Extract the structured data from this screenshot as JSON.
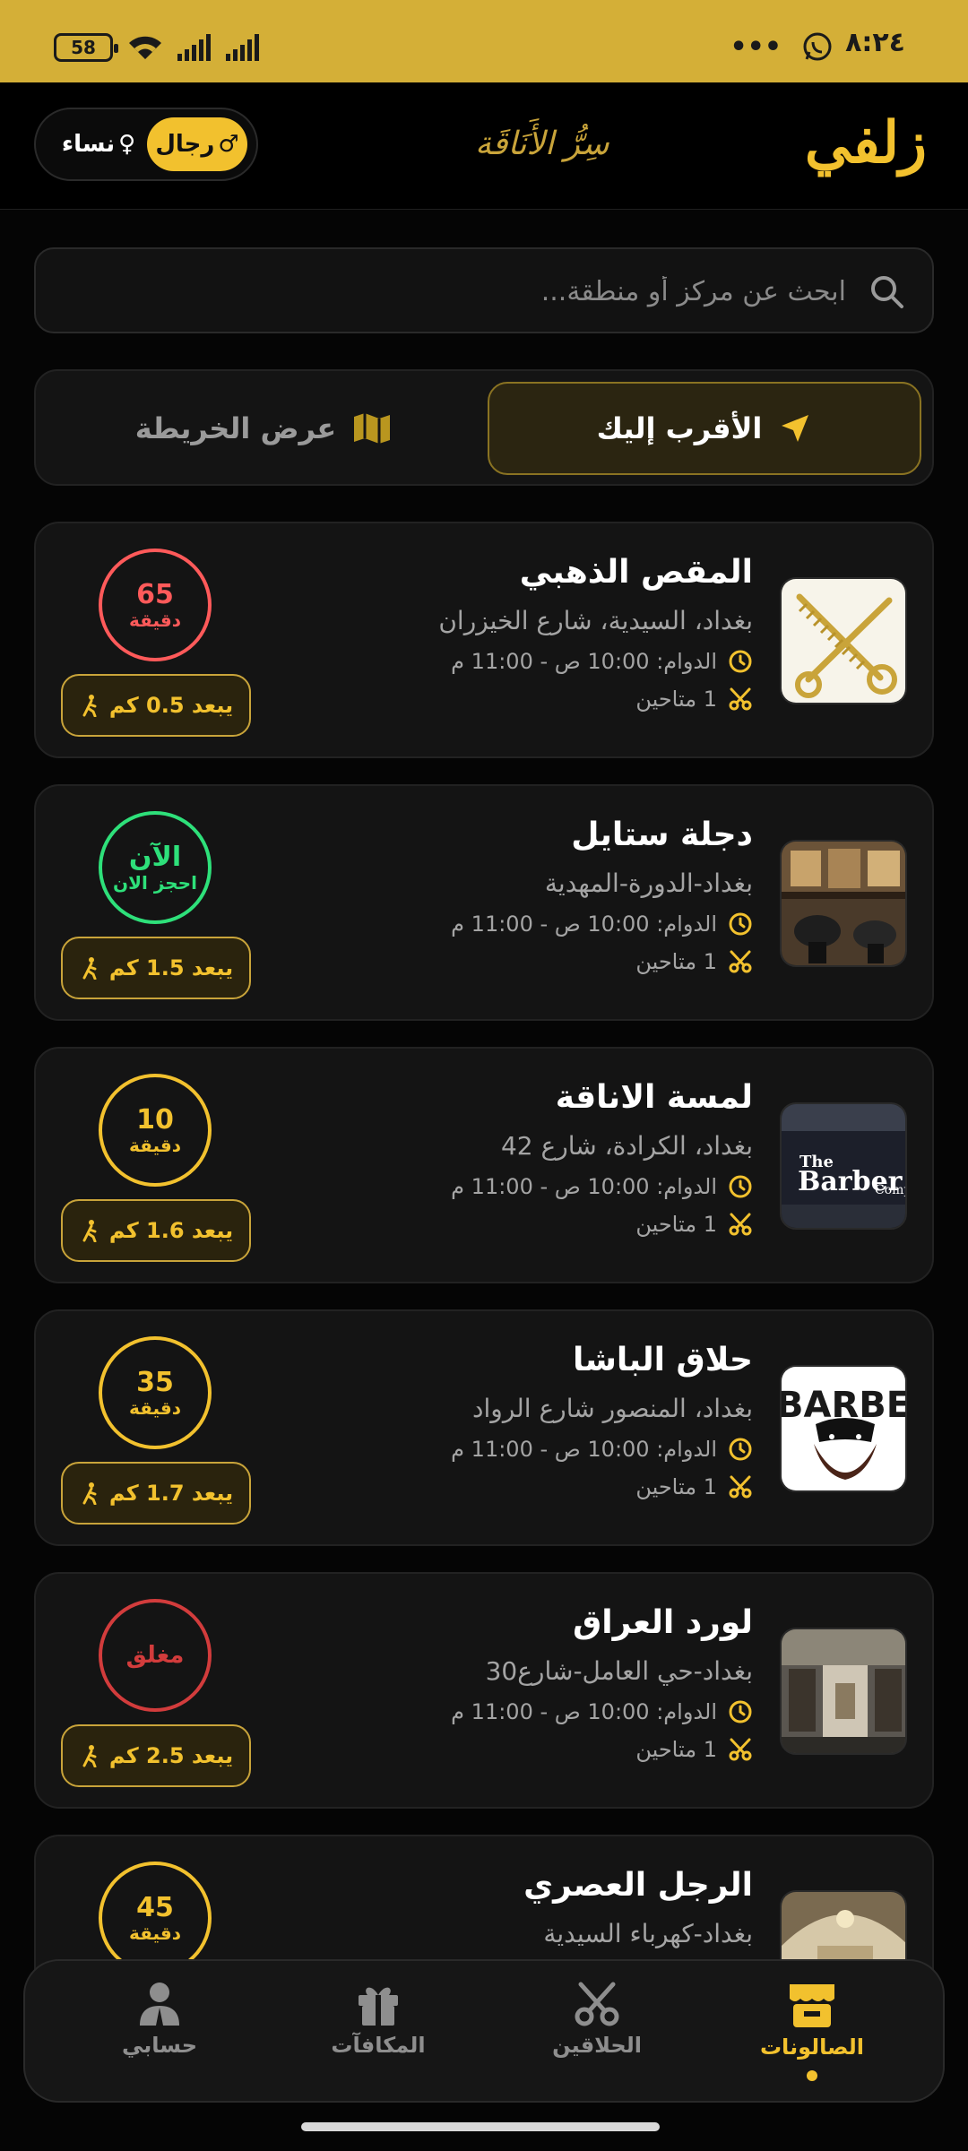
{
  "status_bar": {
    "time": "٨:٢٤",
    "battery": "58"
  },
  "header": {
    "logo": "زلفي",
    "tagline": "سِرُّ الأَنَاقَة",
    "gender": {
      "men": "رجال",
      "women": "نساء",
      "selected": "men"
    }
  },
  "search": {
    "placeholder": "ابحث عن مركز أو منطقة...",
    "value": ""
  },
  "view_toggle": {
    "nearest": "الأقرب إليك",
    "map": "عرض الخريطة",
    "selected": "nearest"
  },
  "colors": {
    "accent": "#f2c12e",
    "status_bar": "#d4af37",
    "green": "#2ee07a",
    "red": "#ff5a5a",
    "closed": "#d23c3c"
  },
  "salons": [
    {
      "name": "المقص الذهبي",
      "address": "بغداد، السيدية، شارع الخيزران",
      "hours": "الدوام: 10:00 ص - 11:00 م",
      "available": "1 متاحين",
      "status_main": "65",
      "status_sub": "دقيقة",
      "status_color": "#ff5a5a",
      "distance": "يبعد 0.5 كم",
      "thumb": "scissors-comb"
    },
    {
      "name": "دجلة ستايل",
      "address": "بغداد-الدورة-المهدية",
      "hours": "الدوام: 10:00 ص - 11:00 م",
      "available": "1 متاحين",
      "status_main": "الآن",
      "status_sub": "احجز الان",
      "status_color": "#2ee07a",
      "distance": "يبعد 1.5 كم",
      "thumb": "salon-interior"
    },
    {
      "name": "لمسة الاناقة",
      "address": "بغداد، الكرادة، شارع 42",
      "hours": "الدوام: 10:00 ص - 11:00 م",
      "available": "1 متاحين",
      "status_main": "10",
      "status_sub": "دقيقة",
      "status_color": "#f2c12e",
      "distance": "يبعد 1.6 كم",
      "thumb": "barber-sign",
      "thumb_text_1": "The",
      "thumb_text_2": "Barber",
      "thumb_text_3": "Comp"
    },
    {
      "name": "حلاق الباشا",
      "address": "بغداد، المنصور شارع الرواد",
      "hours": "الدوام: 10:00 ص - 11:00 م",
      "available": "1 متاحين",
      "status_main": "35",
      "status_sub": "دقيقة",
      "status_color": "#f2c12e",
      "distance": "يبعد 1.7 كم",
      "thumb": "barber-logo",
      "thumb_text_1": "BARBER"
    },
    {
      "name": "لورد العراق",
      "address": "بغداد-حي العامل-شارع30",
      "hours": "الدوام: 10:00 ص - 11:00 م",
      "available": "1 متاحين",
      "status_main": "مغلق",
      "status_sub": "",
      "status_color": "#d23c3c",
      "distance": "يبعد 2.5 كم",
      "thumb": "salon-interior-2"
    },
    {
      "name": "الرجل العصري",
      "address": "بغداد-كهرباء السيدية",
      "hours": "",
      "available": "",
      "status_main": "45",
      "status_sub": "دقيقة",
      "status_color": "#f2c12e",
      "distance": "",
      "thumb": "salon-hall"
    }
  ],
  "nav": {
    "salons": "الصالونات",
    "barbers": "الحلاقين",
    "rewards": "المكافآت",
    "account": "حسابي",
    "active": "salons"
  }
}
